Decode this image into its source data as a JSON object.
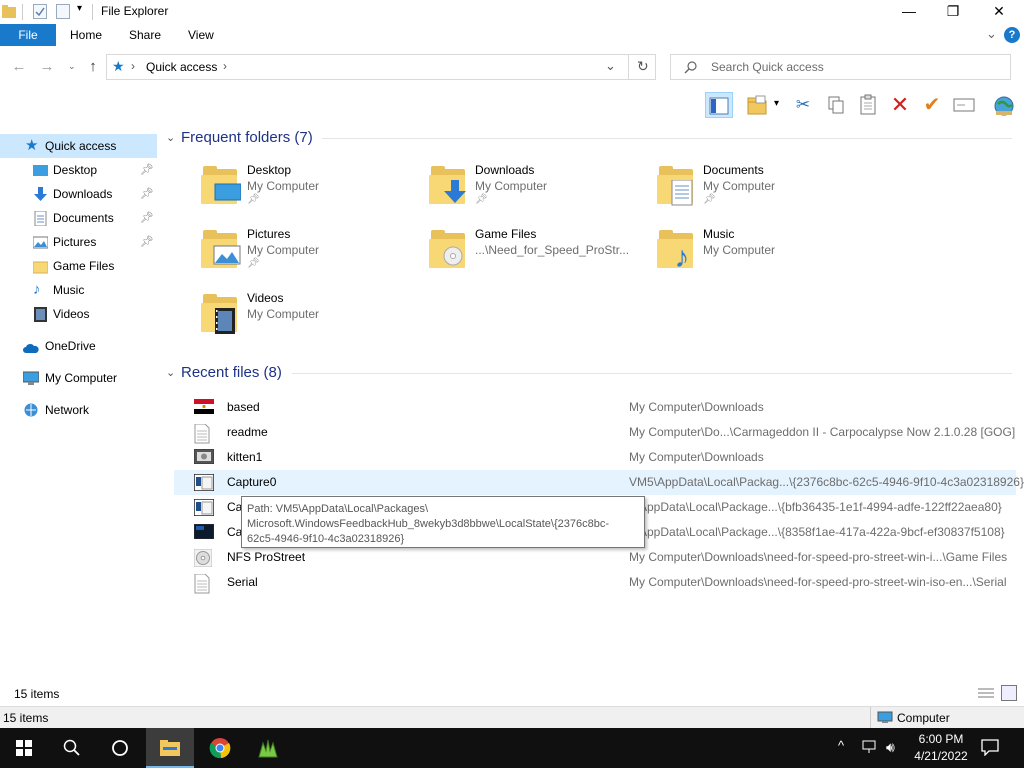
{
  "window": {
    "title": "File Explorer",
    "controls": {
      "minimize": "—",
      "maximize": "❐",
      "close": "✕"
    }
  },
  "ribbon": {
    "tabs": [
      "File",
      "Home",
      "Share",
      "View"
    ],
    "chevron": "⌄",
    "help": "?"
  },
  "address": {
    "back": "←",
    "forward": "→",
    "up": "↑",
    "path": "Quick access",
    "dropdown": "⌄",
    "refresh": "↻",
    "search_placeholder": "Search Quick access"
  },
  "nav": {
    "items": [
      {
        "label": "Quick access",
        "icon": "star-icon",
        "pinned": false,
        "selected": true
      },
      {
        "label": "Desktop",
        "icon": "desktop-icon",
        "pinned": true
      },
      {
        "label": "Downloads",
        "icon": "downloads-icon",
        "pinned": true
      },
      {
        "label": "Documents",
        "icon": "documents-icon",
        "pinned": true
      },
      {
        "label": "Pictures",
        "icon": "pictures-icon",
        "pinned": true
      },
      {
        "label": "Game Files",
        "icon": "folder-icon",
        "pinned": false
      },
      {
        "label": "Music",
        "icon": "music-icon",
        "pinned": false
      },
      {
        "label": "Videos",
        "icon": "videos-icon",
        "pinned": false
      },
      {
        "label": "OneDrive",
        "icon": "onedrive-icon",
        "pinned": false
      },
      {
        "label": "My Computer",
        "icon": "computer-icon",
        "pinned": false
      },
      {
        "label": "Network",
        "icon": "network-icon",
        "pinned": false
      }
    ]
  },
  "frequent": {
    "title": "Frequent folders (7)",
    "folders": [
      {
        "name": "Desktop",
        "location": "My Computer",
        "pinned": true,
        "badge": "desktop"
      },
      {
        "name": "Downloads",
        "location": "My Computer",
        "pinned": true,
        "badge": "downloads"
      },
      {
        "name": "Documents",
        "location": "My Computer",
        "pinned": true,
        "badge": "documents"
      },
      {
        "name": "Pictures",
        "location": "My Computer",
        "pinned": true,
        "badge": "pictures"
      },
      {
        "name": "Game Files",
        "location": "...\\Need_for_Speed_ProStr...",
        "pinned": false,
        "badge": "disc"
      },
      {
        "name": "Music",
        "location": "My Computer",
        "pinned": false,
        "badge": "music"
      },
      {
        "name": "Videos",
        "location": "My Computer",
        "pinned": false,
        "badge": "videos"
      }
    ]
  },
  "recent": {
    "title": "Recent files (8)",
    "files": [
      {
        "name": "based",
        "path": "My Computer\\Downloads",
        "icon": "flag-image-icon"
      },
      {
        "name": "readme",
        "path": "My Computer\\Do...\\Carmageddon II - Carpocalypse Now 2.1.0.28 [GOG]",
        "icon": "text-file-icon"
      },
      {
        "name": "kitten1",
        "path": "My Computer\\Downloads",
        "icon": "image-file-icon"
      },
      {
        "name": "Capture0",
        "path": "VM5\\AppData\\Local\\Packag...\\{2376c8bc-62c5-4946-9f10-4c3a02318926}",
        "icon": "screenshot-file-icon"
      },
      {
        "name": "Ca",
        "path": "5\\AppData\\Local\\Package...\\{bfb36435-1e1f-4994-adfe-122ff22aea80}",
        "icon": "screenshot-file-icon"
      },
      {
        "name": "Ca",
        "path": "5\\AppData\\Local\\Package...\\{8358f1ae-417a-422a-9bcf-ef30837f5108}",
        "icon": "dark-image-file-icon"
      },
      {
        "name": "NFS ProStreet",
        "path": "My Computer\\Downloads\\need-for-speed-pro-street-win-i...\\Game Files",
        "icon": "disc-image-icon"
      },
      {
        "name": "Serial",
        "path": "My Computer\\Downloads\\need-for-speed-pro-street-win-iso-en...\\Serial",
        "icon": "text-file-icon"
      }
    ]
  },
  "tooltip": {
    "lines": [
      "Path: VM5\\AppData\\Local\\Packages\\",
      "Microsoft.WindowsFeedbackHub_8wekyb3d8bbwe\\LocalState\\{2376c8bc-",
      "62c5-4946-9f10-4c3a02318926}"
    ]
  },
  "status": {
    "items_count": "15 items",
    "bar_count": "15 items",
    "location": "Computer"
  },
  "taskbar": {
    "time": "6:00 PM",
    "date": "4/21/2022"
  },
  "colors": {
    "accent": "#1979ca",
    "selection": "#cce8ff",
    "hover": "#e5f3ff",
    "section_title": "#1e3287"
  }
}
